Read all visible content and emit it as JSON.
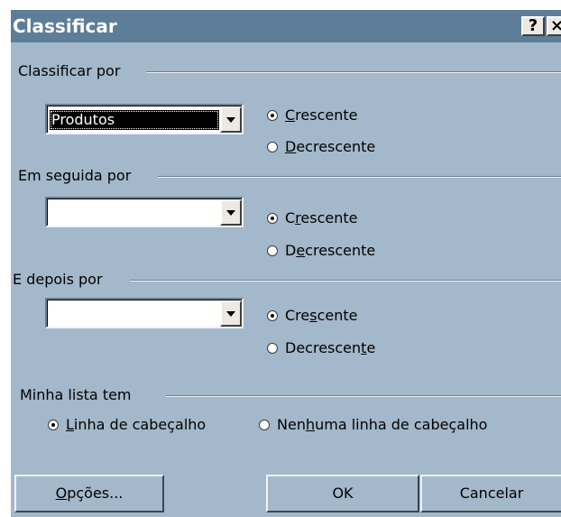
{
  "window": {
    "title": "Classificar",
    "help_button": "?",
    "close_button": "×"
  },
  "groups": [
    {
      "label": "Classificar por",
      "value": "Produtos",
      "options": [
        {
          "pre": "",
          "key": "C",
          "post": "rescente",
          "selected": true
        },
        {
          "pre": "",
          "key": "D",
          "post": "ecrescente",
          "selected": false
        }
      ]
    },
    {
      "label": "Em seguida por",
      "value": "",
      "options": [
        {
          "pre": "C",
          "key": "r",
          "post": "escente",
          "selected": true
        },
        {
          "pre": "D",
          "key": "e",
          "post": "crescente",
          "selected": false
        }
      ]
    },
    {
      "label": "E depois por",
      "value": "",
      "options": [
        {
          "pre": "Cre",
          "key": "s",
          "post": "cente",
          "selected": true
        },
        {
          "pre": "Decrescen",
          "key": "t",
          "post": "e",
          "selected": false
        }
      ]
    }
  ],
  "header_group": {
    "label": "Minha lista tem",
    "options": [
      {
        "pre": "",
        "key": "L",
        "post": "inha de cabeçalho",
        "selected": true
      },
      {
        "pre": "Nen",
        "key": "h",
        "post": "uma linha de cabeçalho",
        "selected": false
      }
    ]
  },
  "buttons": {
    "options": {
      "pre": "",
      "key": "O",
      "post": "pções..."
    },
    "ok": "OK",
    "cancel": "Cancelar"
  }
}
